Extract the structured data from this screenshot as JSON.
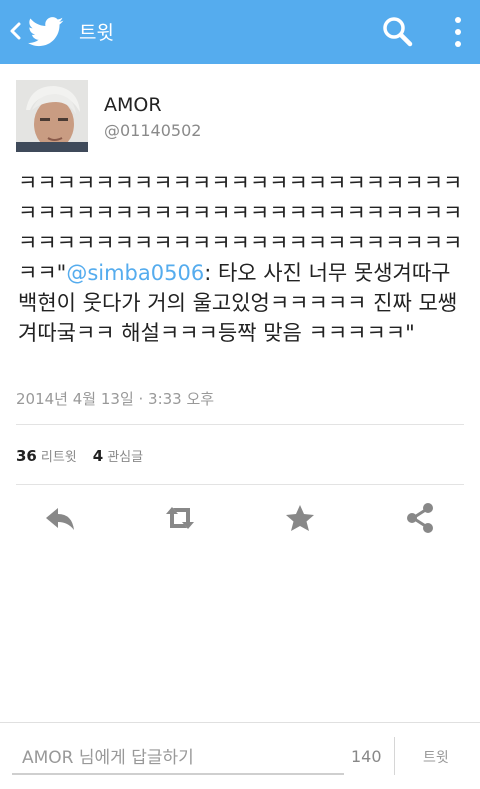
{
  "colors": {
    "accent": "#55acee",
    "mention": "#55acee"
  },
  "header": {
    "title": "트윗",
    "icons": [
      "back-chevron-icon",
      "twitter-bird-icon",
      "search-icon",
      "overflow-menu-icon"
    ]
  },
  "tweet": {
    "name": "AMOR",
    "handle": "@01140502",
    "text_before": "ㅋㅋㅋㅋㅋㅋㅋㅋㅋㅋㅋㅋㅋㅋㅋㅋㅋㅋㅋㅋㅋㅋㅋㅋㅋㅋㅋㅋㅋㅋㅋㅋㅋㅋㅋㅋㅋㅋㅋㅋㅋㅋㅋㅋㅋㅋㅋㅋㅋㅋㅋㅋㅋㅋㅋㅋㅋㅋㅋㅋㅋㅋㅋㅋㅋㅋㅋㅋㅋㅋㅋ\"",
    "mention": "@simba0506",
    "text_after": ": 타오 사진 너무 못생겨따구 백현이 웃다가 거의 울고있엉ㅋㅋㅋㅋㅋ 진짜 모쌩겨따궄ㅋㅋ 해설ㅋㅋㅋ등짝 맞음 ㅋㅋㅋㅋㅋ\"",
    "timestamp": "2014년 4월 13일 · 3:33 오후"
  },
  "stats": {
    "retweets_count": "36",
    "retweets_label": "리트윗",
    "favorites_count": "4",
    "favorites_label": "관심글"
  },
  "actions": [
    "reply-icon",
    "retweet-icon",
    "favorite-star-icon",
    "share-icon"
  ],
  "reply_bar": {
    "placeholder": "AMOR 님에게 답글하기",
    "char_count": "140",
    "send_label": "트윗"
  }
}
